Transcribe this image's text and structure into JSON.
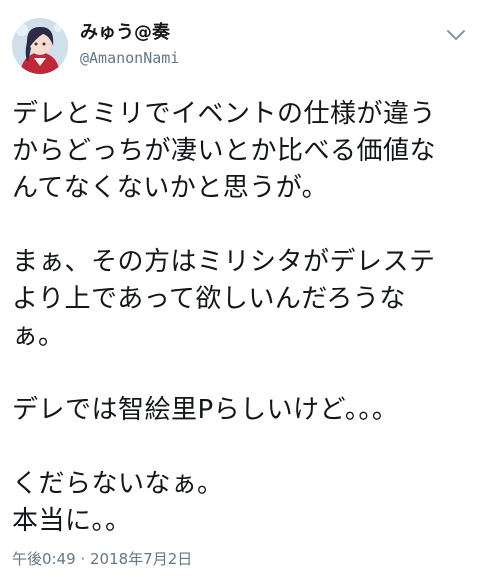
{
  "user": {
    "display_name": "みゅう@奏",
    "handle": "@AmanonNami"
  },
  "tweet": {
    "lines": [
      "デレとミリでイベントの仕様が違う",
      "からどっちが凄いとか比べる価値な",
      "んてなくないかと思うが。",
      "",
      "まぁ、その方はミリシタがデレステ",
      "より上であって欲しいんだろうな",
      "ぁ。",
      "",
      "デレでは智絵里Pらしいけど。。。",
      "",
      "くだらないなぁ。",
      "本当に。。"
    ]
  },
  "timestamp": "午後0:49 · 2018年7月2日",
  "icons": {
    "avatar": "avatar-image",
    "menu": "chevron-down-icon"
  },
  "colors": {
    "text": "#14171a",
    "secondary": "#657786"
  }
}
